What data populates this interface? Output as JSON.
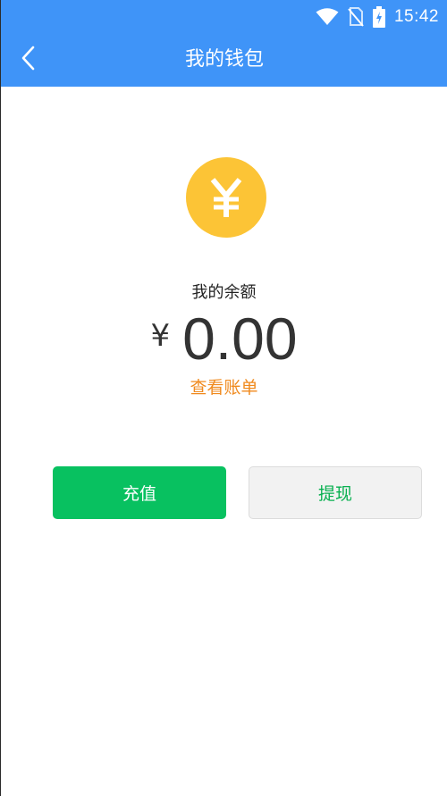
{
  "status_bar": {
    "time": "15:42",
    "icons": [
      "wifi-icon",
      "no-sim-icon",
      "battery-charging-icon"
    ]
  },
  "header": {
    "title": "我的钱包",
    "back_icon": "chevron-left-icon"
  },
  "wallet": {
    "coin_symbol": "¥",
    "balance_label": "我的余额",
    "currency_symbol": "¥",
    "balance": "0.00",
    "view_bill_link": "查看账单"
  },
  "actions": {
    "recharge_label": "充值",
    "withdraw_label": "提现"
  },
  "colors": {
    "header_bg": "#3f94f8",
    "coin": "#fcc436",
    "link": "#f08a1e",
    "primary_button": "#08c160",
    "secondary_button_bg": "#f2f2f2",
    "secondary_button_text": "#08b050"
  }
}
